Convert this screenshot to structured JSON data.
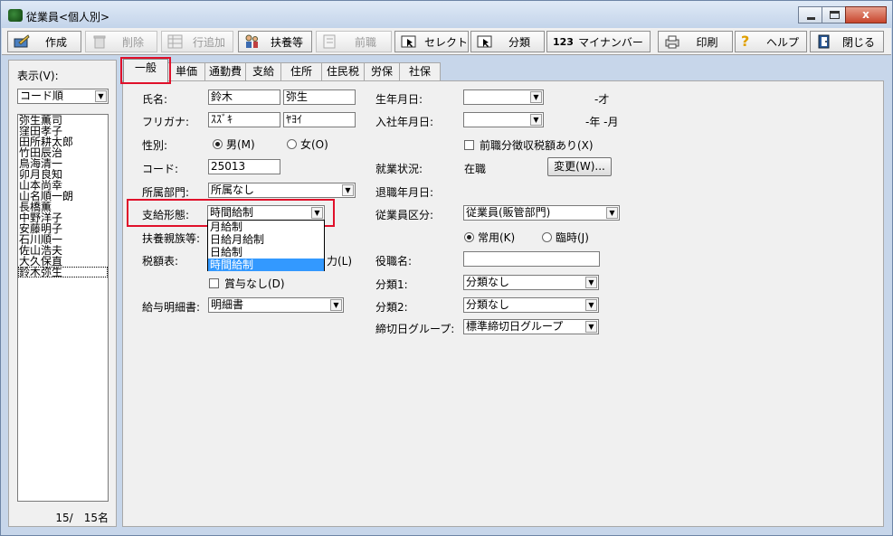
{
  "window": {
    "title": "従業員<個人別>",
    "close_label": "x"
  },
  "toolbar": {
    "create": "作成",
    "delete": "削除",
    "add_row": "行追加",
    "dependents": "扶養等",
    "prev_job": "前職",
    "select": "セレクト",
    "classify": "分類",
    "mynumber": "マイナンバー",
    "mynumber_icon_text": "123",
    "print": "印刷",
    "help": "ヘルプ",
    "close": "閉じる"
  },
  "left": {
    "display_label": "表示(V):",
    "sort_value": "コード順",
    "employees": [
      "弥生薫司",
      "窪田孝子",
      "田所耕太郎",
      "竹田辰治",
      "鳥海清一",
      "卯月良知",
      "山本尚幸",
      "山名順一朗",
      "長橋薫",
      "中野洋子",
      "安藤明子",
      "石川順一",
      "佐山浩夫",
      "大久保直",
      "鈴木弥生"
    ],
    "count": "15/　15名"
  },
  "tabs": [
    "一般",
    "単価",
    "通勤費",
    "支給",
    "住所",
    "住民税",
    "労保",
    "社保"
  ],
  "form": {
    "name_label": "氏名:",
    "last_name": "鈴木",
    "first_name": "弥生",
    "kana_label": "フリガナ:",
    "kana_last": "ｽｽﾞｷ",
    "kana_first": "ﾔﾖｲ",
    "gender_label": "性別:",
    "male": "男(M)",
    "female": "女(O)",
    "code_label": "コード:",
    "code": "25013",
    "dept_label": "所属部門:",
    "dept": "所属なし",
    "pay_type_label": "支給形態:",
    "pay_type": "時間給制",
    "pay_type_options": [
      "月給制",
      "日給月給制",
      "日給制",
      "時間給制"
    ],
    "dependents_label": "扶養親族等:",
    "tax_table_label": "税額表:",
    "manual_input_tail": "力(L)",
    "no_bonus": "賞与なし(D)",
    "payslip_label": "給与明細書:",
    "payslip": "明細書",
    "birth_label": "生年月日:",
    "age": "-才",
    "join_label": "入社年月日:",
    "tenure": "-年 -月",
    "prev_tax_label": "前職分徴収税額あり(X)",
    "status_label": "就業状況:",
    "status": "在職",
    "change_button": "変更(W)...",
    "retire_label": "退職年月日:",
    "emp_type_label": "従業員区分:",
    "emp_type": "従業員(販管部門)",
    "regular": "常用(K)",
    "temporary": "臨時(J)",
    "position_label": "役職名:",
    "class1_label": "分類1:",
    "class1": "分類なし",
    "class2_label": "分類2:",
    "class2": "分類なし",
    "cutoff_label": "締切日グループ:",
    "cutoff": "標準締切日グループ"
  }
}
